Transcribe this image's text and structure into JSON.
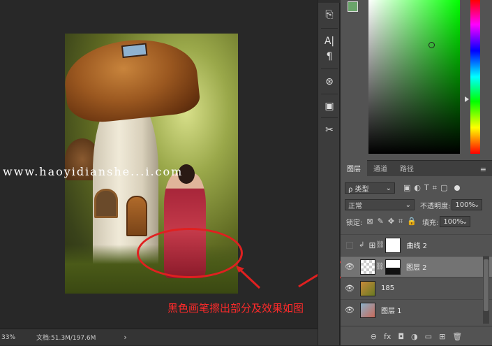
{
  "watermark": "www.haoyidianshe...i.com",
  "annotation": "黑色画笔擦出部分及效果如图",
  "status": {
    "zoom": "33%",
    "doc": "文档:51.3M/197.6M",
    "arrow": "›"
  },
  "tools": [
    "brush-history-icon",
    "text-paragraph-icon",
    "clone-source-icon",
    "folder-history-icon",
    "tools-crossed-icon"
  ],
  "tool_glyphs": [
    "⎘",
    "A|",
    "¶",
    "⊛",
    "▣",
    "✂"
  ],
  "colors": {
    "foreground": "#6aa46a",
    "background": "#2a2a2a",
    "annotation_red": "#e02020",
    "panel_bg": "#535353"
  },
  "layers_panel": {
    "tabs": [
      "图层",
      "通道",
      "路径"
    ],
    "filter": {
      "label": "ρ 类型",
      "icons": [
        "▣",
        "◐",
        "T",
        "⌗",
        "▢"
      ]
    },
    "blend": {
      "mode": "正常",
      "opacity_label": "不透明度:",
      "opacity": "100%"
    },
    "lock": {
      "label": "锁定:",
      "icons": [
        "⊠",
        "✎",
        "✥",
        "⌗",
        "🔒"
      ],
      "fill_label": "填充:",
      "fill": "100%"
    },
    "layers": [
      {
        "name": "曲线 2",
        "visible": false,
        "selected": false,
        "type": "adjustment"
      },
      {
        "name": "图层 2",
        "visible": true,
        "selected": true,
        "type": "masked"
      },
      {
        "name": "185",
        "visible": true,
        "selected": false,
        "type": "image"
      },
      {
        "name": "图层 1",
        "visible": true,
        "selected": false,
        "type": "image"
      }
    ],
    "footer_icons": [
      "⊖",
      "fx",
      "◘",
      "◑",
      "▭",
      "⊞",
      "🗑"
    ]
  }
}
